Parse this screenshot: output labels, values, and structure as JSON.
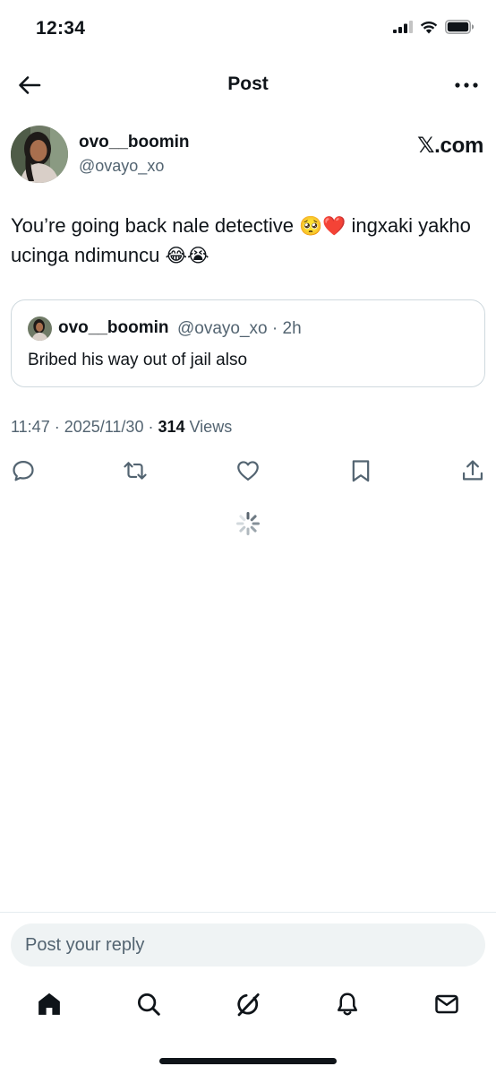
{
  "status_bar": {
    "time": "12:34"
  },
  "nav": {
    "title": "Post"
  },
  "author": {
    "name": "ovo__boomin",
    "handle": "@ovayo_xo",
    "source": "𝕏.com"
  },
  "tweet": {
    "text_1": "You’re going back nale detective ",
    "emoji_1": "🥺❤️",
    "text_2": " ingxaki yakho ucinga ndimuncu ",
    "emoji_2": "😂😭"
  },
  "quote": {
    "name": "ovo__boomin",
    "meta": "@ovayo_xo · 2h",
    "text": "Bribed his way out of jail also"
  },
  "meta": {
    "time_date": "11:47 · 2025/11/30 · ",
    "views_count": "314",
    "views_label": " Views"
  },
  "reply": {
    "placeholder": "Post your reply"
  },
  "icons": {
    "back": "arrow-left-icon",
    "more": "more-horizontal-icon",
    "actions": [
      "reply-icon",
      "repost-icon",
      "like-icon",
      "bookmark-icon",
      "share-icon"
    ],
    "tabs": [
      "home-icon",
      "search-icon",
      "grok-icon",
      "notifications-icon",
      "messages-icon"
    ]
  },
  "colors": {
    "text": "#0f1419",
    "secondary": "#536471",
    "border": "#cfd9de",
    "reply_bg": "#eff3f4"
  }
}
